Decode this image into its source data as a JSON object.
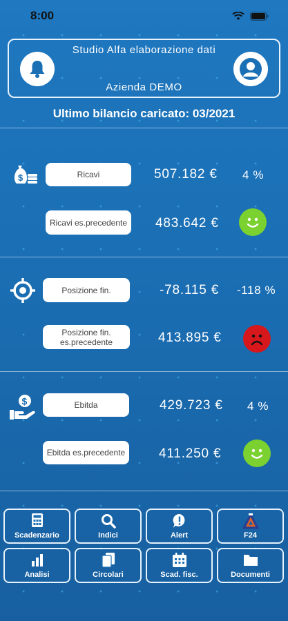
{
  "status_bar": {
    "time": "8:00"
  },
  "header": {
    "studio_name": "Studio Alfa elaborazione dati",
    "company": "Azienda DEMO"
  },
  "last_balance": "Ultimo bilancio caricato: 03/2021",
  "metrics": [
    {
      "icon": "money-bag-icon",
      "label": "Ricavi",
      "amount": "507.182 €",
      "percent": "4 %",
      "prev_label": "Ricavi es.precedente",
      "prev_amount": "483.642 €",
      "trend": "happy"
    },
    {
      "icon": "target-icon",
      "label": "Posizione fin.",
      "amount": "-78.115 €",
      "percent": "-118 %",
      "prev_label": "Posizione fin. es.precedente",
      "prev_amount": "413.895 €",
      "trend": "sad"
    },
    {
      "icon": "hand-coin-icon",
      "label": "Ebitda",
      "amount": "429.723 €",
      "percent": "4 %",
      "prev_label": "Ebitda es.precedente",
      "prev_amount": "411.250 €",
      "trend": "happy"
    }
  ],
  "menu": [
    {
      "label": "Scadenzario",
      "icon": "calculator-icon"
    },
    {
      "label": "Indici",
      "icon": "search-icon"
    },
    {
      "label": "Alert",
      "icon": "alert-icon"
    },
    {
      "label": "F24",
      "icon": "f24-logo-icon"
    },
    {
      "label": "Analisi",
      "icon": "bar-chart-icon"
    },
    {
      "label": "Circolari",
      "icon": "documents-icon"
    },
    {
      "label": "Scad. fisc.",
      "icon": "calendar-icon"
    },
    {
      "label": "Documenti",
      "icon": "folder-icon"
    }
  ],
  "colors": {
    "happy": "#7bd12f",
    "sad": "#d6171c",
    "background": "#1b6fb4"
  }
}
